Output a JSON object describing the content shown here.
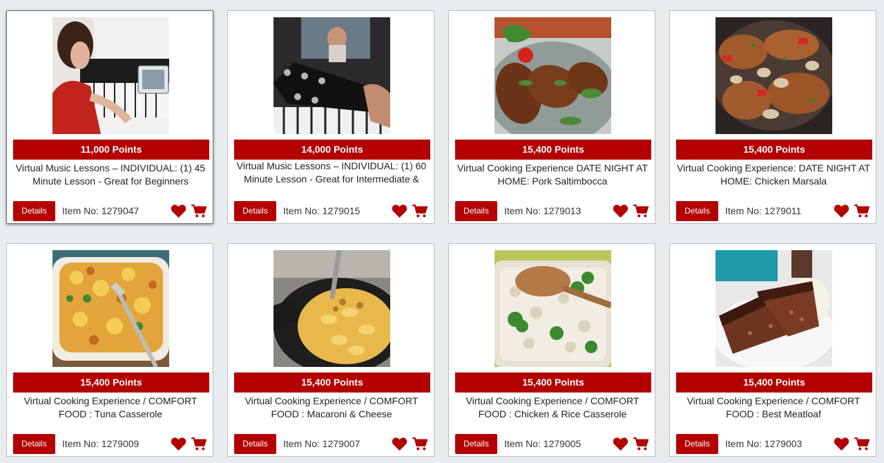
{
  "colors": {
    "accent": "#b30000",
    "background": "#e9ecef",
    "card": "#ffffff"
  },
  "icons": {
    "favorite": "heart-icon",
    "cart": "cart-icon"
  },
  "products": [
    {
      "points": "11,000 Points",
      "title": "Virtual Music Lessons – INDIVIDUAL: (1) 45 Minute Lesson - Great for Beginners",
      "details_label": "Details",
      "item_no": "Item No: 1279047",
      "image": "woman-playing-piano-with-tablet"
    },
    {
      "points": "14,000 Points",
      "title": "Virtual Music Lessons – INDIVIDUAL: (1) 60 Minute Lesson - Great for Intermediate & Advanced",
      "details_label": "Details",
      "item_no": "Item No: 1279015",
      "image": "guitar-headstock-and-video-call"
    },
    {
      "points": "15,400 Points",
      "title": "Virtual Cooking Experience DATE NIGHT AT HOME: Pork Saltimbocca",
      "details_label": "Details",
      "item_no": "Item No: 1279013",
      "image": "pork-saltimbocca-plate"
    },
    {
      "points": "15,400 Points",
      "title": "Virtual Cooking Experience: DATE NIGHT AT HOME: Chicken Marsala",
      "details_label": "Details",
      "item_no": "Item No: 1279011",
      "image": "chicken-marsala-skillet"
    },
    {
      "points": "15,400 Points",
      "title": "Virtual Cooking Experience / COMFORT FOOD : Tuna Casserole",
      "details_label": "Details",
      "item_no": "Item No: 1279009",
      "image": "tuna-casserole-with-fork"
    },
    {
      "points": "15,400 Points",
      "title": "Virtual Cooking Experience / COMFORT FOOD : Macaroni & Cheese",
      "details_label": "Details",
      "item_no": "Item No: 1279007",
      "image": "mac-and-cheese-skillet"
    },
    {
      "points": "15,400 Points",
      "title": "Virtual Cooking Experience / COMFORT FOOD : Chicken & Rice Casserole",
      "details_label": "Details",
      "item_no": "Item No: 1279005",
      "image": "chicken-rice-casserole"
    },
    {
      "points": "15,400 Points",
      "title": "Virtual Cooking Experience / COMFORT FOOD : Best Meatloaf",
      "details_label": "Details",
      "item_no": "Item No: 1279003",
      "image": "meatloaf-slices"
    }
  ]
}
